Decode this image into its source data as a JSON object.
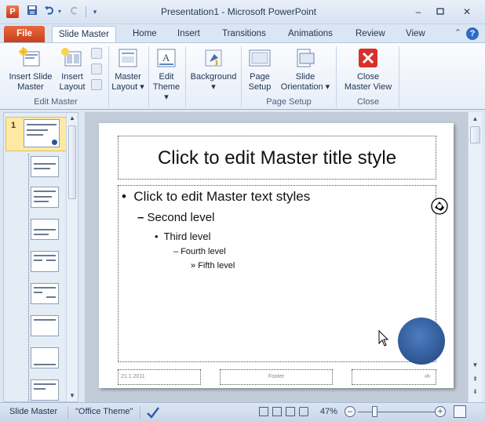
{
  "window": {
    "title": "Presentation1  -  Microsoft PowerPoint",
    "app_icon": "P",
    "controls": [
      "minimize-icon",
      "maximize-icon",
      "close-icon"
    ]
  },
  "qat": [
    "save-icon",
    "undo-icon",
    "redo-icon",
    "customize-icon"
  ],
  "tabs": [
    {
      "label": "File"
    },
    {
      "label": "Slide Master",
      "active": true
    },
    {
      "label": "Home"
    },
    {
      "label": "Insert"
    },
    {
      "label": "Transitions"
    },
    {
      "label": "Animations"
    },
    {
      "label": "Review"
    },
    {
      "label": "View"
    }
  ],
  "ribbon": {
    "edit_master": {
      "insert_slide_master": [
        "Insert Slide",
        "Master"
      ],
      "insert_layout": [
        "Insert",
        "Layout"
      ],
      "group_label": "Edit Master"
    },
    "master_layout": [
      "Master",
      "Layout"
    ],
    "edit_theme": [
      "Edit",
      "Theme"
    ],
    "background": "Background",
    "page_setup": {
      "page_setup_btn": [
        "Page",
        "Setup"
      ],
      "slide_orientation": [
        "Slide",
        "Orientation"
      ],
      "group_label": "Page Setup"
    },
    "close": {
      "close_master_view": [
        "Close",
        "Master View"
      ],
      "group_label": "Close"
    }
  },
  "thumbnails": {
    "selected_number": "1",
    "count": 9
  },
  "slide": {
    "title": "Click to edit Master title style",
    "levels": [
      {
        "bullet": "•",
        "text": "Click to edit Master text styles"
      },
      {
        "bullet": "–",
        "text": "Second level"
      },
      {
        "bullet": "•",
        "text": "Third level"
      },
      {
        "bullet": "–",
        "text": "Fourth level"
      },
      {
        "bullet": "»",
        "text": "Fifth level"
      }
    ],
    "footer_date": "21.1.2011",
    "footer_center": "Footer",
    "footer_number": "‹#›"
  },
  "status": {
    "view_name": "Slide Master",
    "theme": "\"Office Theme\"",
    "zoom": "47%"
  }
}
